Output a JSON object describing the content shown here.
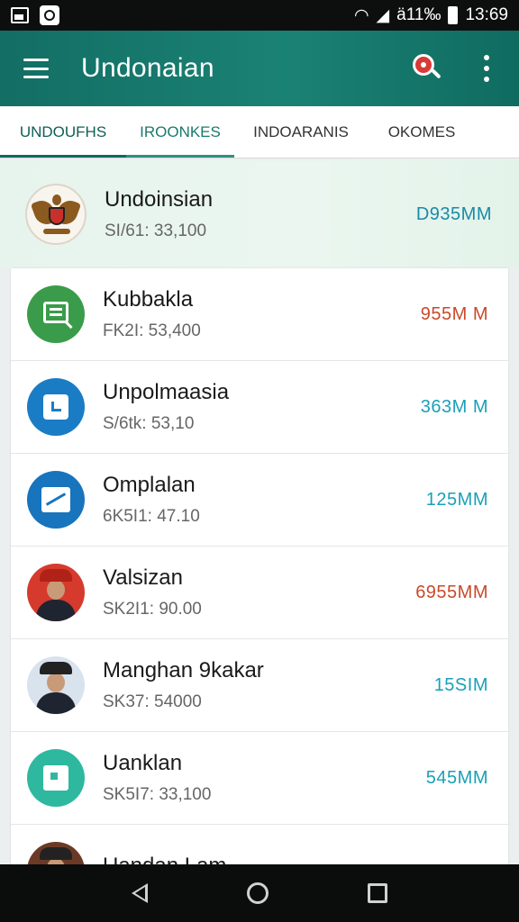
{
  "status_bar": {
    "signal_text": "ä11‰",
    "time": "13:69"
  },
  "app_bar": {
    "title": "Undonaian"
  },
  "tabs": [
    "UNDOUFHS",
    "IROONKES",
    "INDOARANIS",
    "OKOMES"
  ],
  "featured": {
    "name": "Undoinsian",
    "sub": "SI/61: 33,100",
    "value": "D935MM",
    "value_color": "#1a8aa8",
    "avatar_icon": "garuda-crest-icon"
  },
  "list": [
    {
      "name": "Kubbakla",
      "sub": "FK2I: 53,400",
      "value": "955M M",
      "value_color": "#c84a2a",
      "avatar_icon": "message-icon"
    },
    {
      "name": "Unpolmaasia",
      "sub": "S/6tk: 53,10",
      "value": "363M M",
      "value_color": "#1aa0b8",
      "avatar_icon": "calendar-icon"
    },
    {
      "name": "Omplalan",
      "sub": "6K5I1: 47.10",
      "value": "125MM",
      "value_color": "#1aa0b8",
      "avatar_icon": "trend-chart-icon"
    },
    {
      "name": "Valsizan",
      "sub": "SK2I1: 90.00",
      "value": "6955MM",
      "value_color": "#c84a2a",
      "avatar_icon": "person-avatar-icon"
    },
    {
      "name": "Manghan 9kakar",
      "sub": "SK37: 54000",
      "value": "15SIM",
      "value_color": "#1aa0b8",
      "avatar_icon": "person-avatar-icon"
    },
    {
      "name": "Uanklan",
      "sub": "SK5I7: 33,100",
      "value": "545MM",
      "value_color": "#1aa0b8",
      "avatar_icon": "chat-icon"
    },
    {
      "name": "Uandan Lam",
      "sub": "",
      "value": "",
      "value_color": "#1aa0b8",
      "avatar_icon": "person-avatar-icon"
    }
  ]
}
